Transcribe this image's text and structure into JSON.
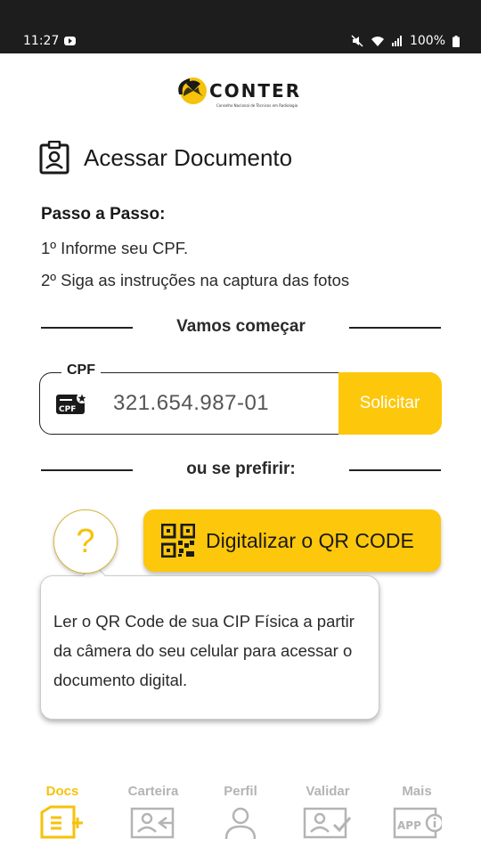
{
  "status_bar": {
    "time": "11:27",
    "battery": "100%"
  },
  "header": {
    "logo_text": "CONTER",
    "logo_subtitle": "Conselho Nacional de Técnicos em Radiologia"
  },
  "page": {
    "title": "Acessar Documento"
  },
  "instructions": {
    "title": "Passo a Passo:",
    "step1": "1º Informe seu CPF.",
    "step2": "2º Siga as instruções na captura das fotos"
  },
  "section_start": {
    "label": "Vamos começar"
  },
  "cpf_field": {
    "label": "CPF",
    "icon_text": "CPF",
    "value": "321.654.987-01",
    "button_label": "Solicitar"
  },
  "section_alt": {
    "label": "ou se prefirir:"
  },
  "qr": {
    "help_symbol": "?",
    "button_label": "Digitalizar o QR CODE"
  },
  "tooltip": {
    "text": "Ler o QR Code de sua CIP Física a partir da câmera do seu celular para acessar o documento digital."
  },
  "nav": {
    "items": [
      {
        "label": "Docs",
        "icon": "docs-add-icon",
        "active": true
      },
      {
        "label": "Carteira",
        "icon": "wallet-card-icon",
        "active": false
      },
      {
        "label": "Perfil",
        "icon": "person-icon",
        "active": false
      },
      {
        "label": "Validar",
        "icon": "validate-card-icon",
        "active": false
      },
      {
        "label": "Mais",
        "icon": "app-more-icon",
        "active": false
      }
    ]
  },
  "colors": {
    "accent": "#fdc70c",
    "status_bar": "#1d1d1d",
    "inactive_nav": "#b4b4b4"
  }
}
